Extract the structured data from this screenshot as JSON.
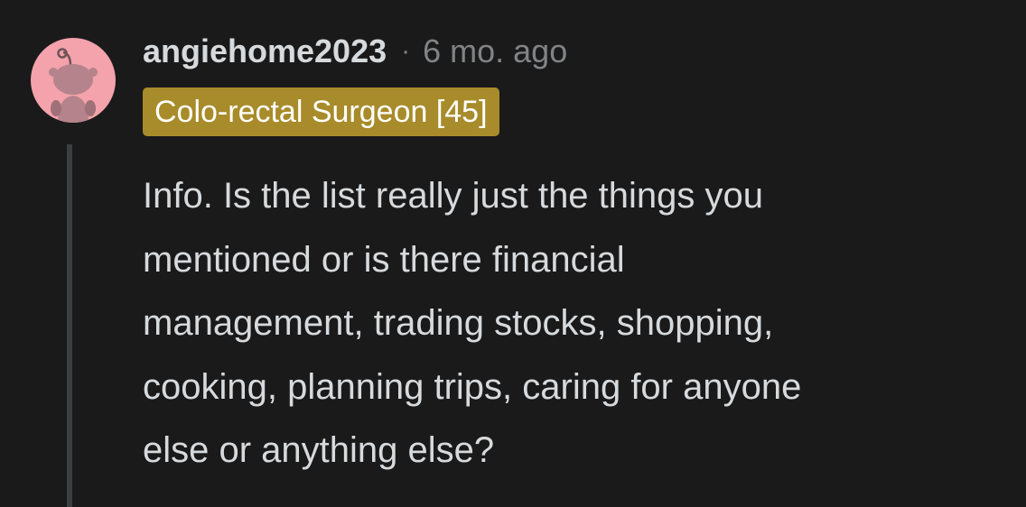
{
  "comment": {
    "avatar_icon": "reddit-snoo-avatar-icon",
    "avatar_bg_color": "#f4a2ab",
    "username": "angiehome2023",
    "separator": "·",
    "timestamp": "6 mo. ago",
    "flair": {
      "text": "Colo-rectal Surgeon [45]",
      "bg_color": "#a88b2a"
    },
    "body_lines": [
      "Info. Is the list really just the things you",
      "mentioned or is there financial",
      "management, trading stocks, shopping,",
      "cooking, planning trips, caring for anyone",
      "else or anything else?"
    ]
  }
}
